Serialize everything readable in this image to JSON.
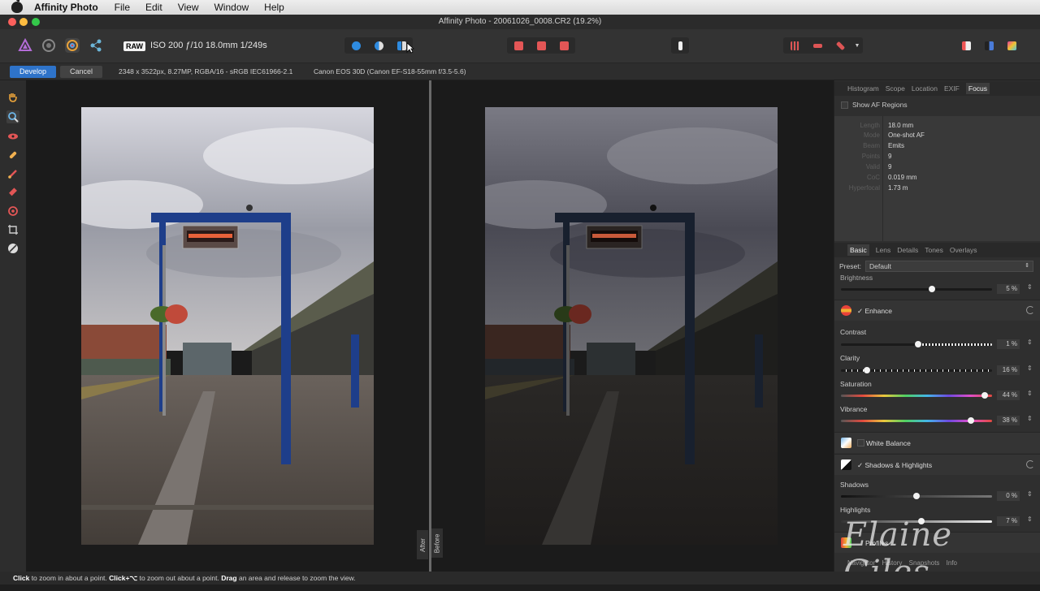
{
  "menubar": {
    "app": "Affinity Photo",
    "items": [
      "File",
      "Edit",
      "View",
      "Window",
      "Help"
    ]
  },
  "window": {
    "title": "Affinity Photo - 20061026_0008.CR2 (19.2%)"
  },
  "toolbar": {
    "raw_badge": "RAW",
    "exif": "ISO 200 ƒ/10 18.0mm 1/249s"
  },
  "context": {
    "develop_label": "Develop",
    "cancel_label": "Cancel",
    "image_info": "2348 x 3522px, 8.27MP, RGBA/16 - sRGB IEC61966-2.1",
    "lens_info": "Canon EOS 30D (Canon EF-S18-55mm f/3.5-5.6)"
  },
  "canvas": {
    "after_label": "After",
    "before_label": "Before"
  },
  "panel": {
    "top_tabs": [
      "Histogram",
      "Scope",
      "Location",
      "EXIF",
      "Focus"
    ],
    "show_af": "Show AF Regions",
    "focus_keys": [
      "Length",
      "Mode",
      "Beam",
      "Points",
      "Valid",
      "CoC",
      "Hyperfocal"
    ],
    "focus_values": [
      "18.0 mm",
      "One-shot AF",
      "Emits",
      "9",
      "9",
      "0.019 mm",
      "1.73 m"
    ],
    "studio_tabs": [
      "Basic",
      "Lens",
      "Details",
      "Tones",
      "Overlays"
    ],
    "preset_label": "Preset:",
    "preset_value": "Default",
    "brightness_label": "Brightness",
    "brightness_value": "5 %",
    "enhance_label": "✓ Enhance",
    "contrast_label": "Contrast",
    "contrast_value": "1 %",
    "clarity_label": "Clarity",
    "clarity_value": "16 %",
    "saturation_label": "Saturation",
    "saturation_value": "44 %",
    "vibrance_label": "Vibrance",
    "vibrance_value": "38 %",
    "wb_label": "White Balance",
    "sh_label": "✓ Shadows & Highlights",
    "shadows_label": "Shadows",
    "shadows_value": "0 %",
    "highlights_label": "Highlights",
    "highlights_value": "7 %",
    "profiles_label": "Profiles",
    "bottom_tabs": [
      "Navigator",
      "History",
      "Snapshots",
      "Info"
    ]
  },
  "watermark": "Elaine Giles",
  "status": {
    "click": "Click",
    "t1": " to zoom in about a point. ",
    "click2": "Click+⌥",
    "t2": " to zoom out about a point. ",
    "drag": "Drag",
    "t3": " an area and release to zoom the view."
  },
  "colors": {
    "accent": "#2e73c9",
    "panel": "#2f2f2f",
    "canvas": "#1b1b1b"
  }
}
